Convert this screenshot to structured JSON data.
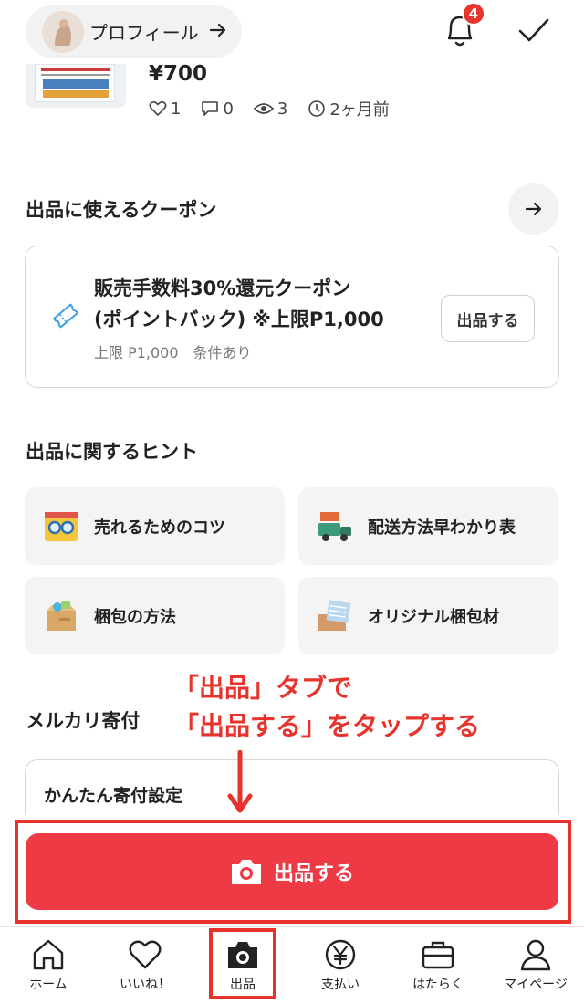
{
  "header": {
    "profile_label": "プロフィール",
    "notification_count": "4"
  },
  "item": {
    "price": "¥700",
    "likes": "1",
    "comments": "0",
    "views": "3",
    "time": "2ヶ月前"
  },
  "coupon_section": {
    "title": "出品に使えるクーポン",
    "coupon_title_line1": "販売手数料30%還元クーポン",
    "coupon_title_line2": "(ポイントバック) ※上限P1,000",
    "coupon_sub": "上限 P1,000　条件あり",
    "button_label": "出品する"
  },
  "tips_section": {
    "title": "出品に関するヒント",
    "items": [
      {
        "label": "売れるためのコツ",
        "icon": "glasses-card-icon"
      },
      {
        "label": "配送方法早わかり表",
        "icon": "delivery-truck-icon"
      },
      {
        "label": "梱包の方法",
        "icon": "package-box-icon"
      },
      {
        "label": "オリジナル梱包材",
        "icon": "packing-material-icon"
      }
    ]
  },
  "donation_section": {
    "title": "メルカリ寄付",
    "card_label": "かんたん寄付設定"
  },
  "annotation": {
    "line1": "「出品」タブで",
    "line2": "「出品する」をタップする"
  },
  "cta": {
    "label": "出品する"
  },
  "tabbar": {
    "items": [
      {
        "label": "ホーム",
        "icon": "home-icon"
      },
      {
        "label": "いいね！",
        "icon": "heart-icon"
      },
      {
        "label": "出品",
        "icon": "camera-icon"
      },
      {
        "label": "支払い",
        "icon": "yen-icon"
      },
      {
        "label": "はたらく",
        "icon": "briefcase-icon"
      },
      {
        "label": "マイページ",
        "icon": "person-icon"
      }
    ]
  },
  "colors": {
    "accent": "#ee3a45",
    "annotation": "#e8322c",
    "ticket_icon": "#3aa0e0"
  }
}
